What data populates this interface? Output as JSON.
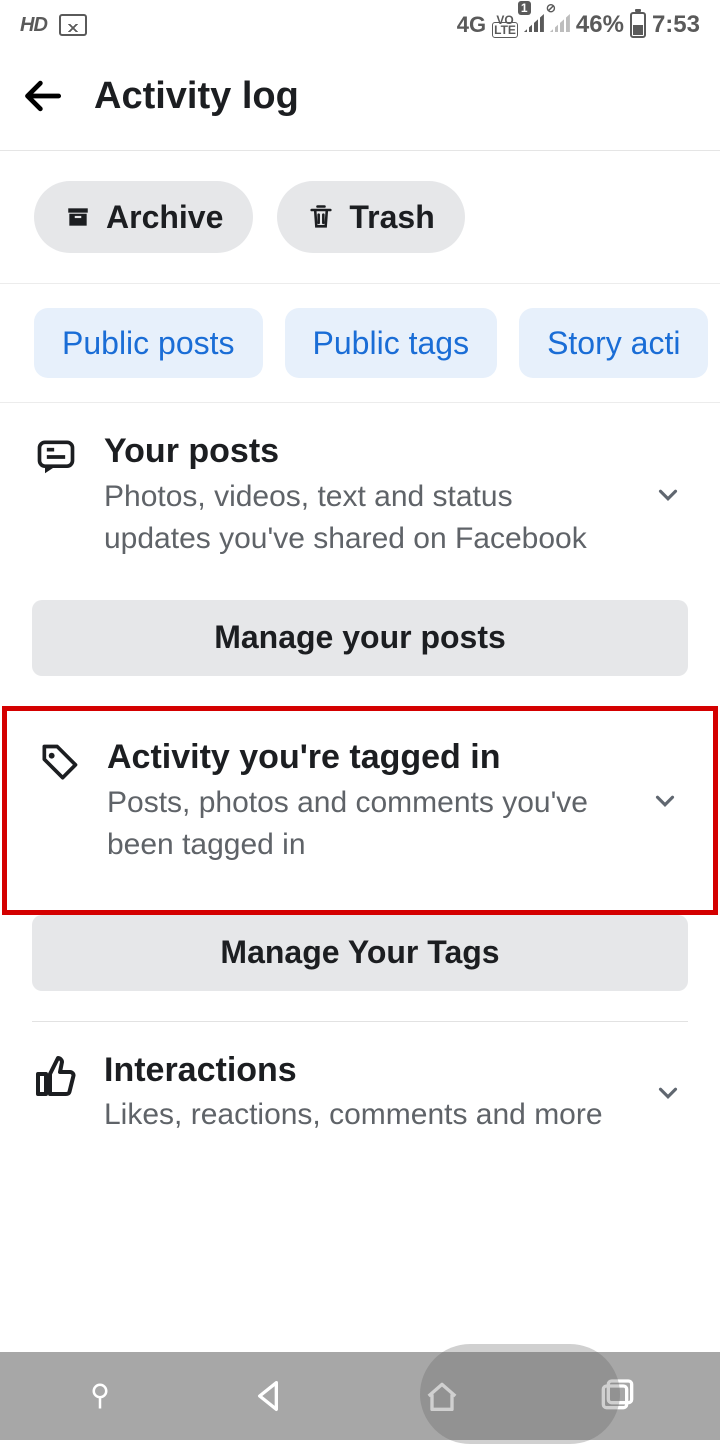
{
  "status": {
    "hd": "HD",
    "network": "4G",
    "volte_top": "VO",
    "volte_bot": "LTE",
    "sim_badge": "1",
    "battery_pct": "46%",
    "time": "7:53"
  },
  "header": {
    "title": "Activity log"
  },
  "pills": {
    "archive": "Archive",
    "trash": "Trash"
  },
  "filters": {
    "public_posts": "Public posts",
    "public_tags": "Public tags",
    "story_activity": "Story acti"
  },
  "sections": {
    "posts": {
      "title": "Your posts",
      "desc": "Photos, videos, text and status updates you've shared on Facebook",
      "manage": "Manage your posts"
    },
    "tagged": {
      "title": "Activity you're tagged in",
      "desc": "Posts, photos and comments you've been tagged in",
      "manage": "Manage Your Tags"
    },
    "interactions": {
      "title": "Interactions",
      "desc": "Likes, reactions, comments and more"
    }
  }
}
